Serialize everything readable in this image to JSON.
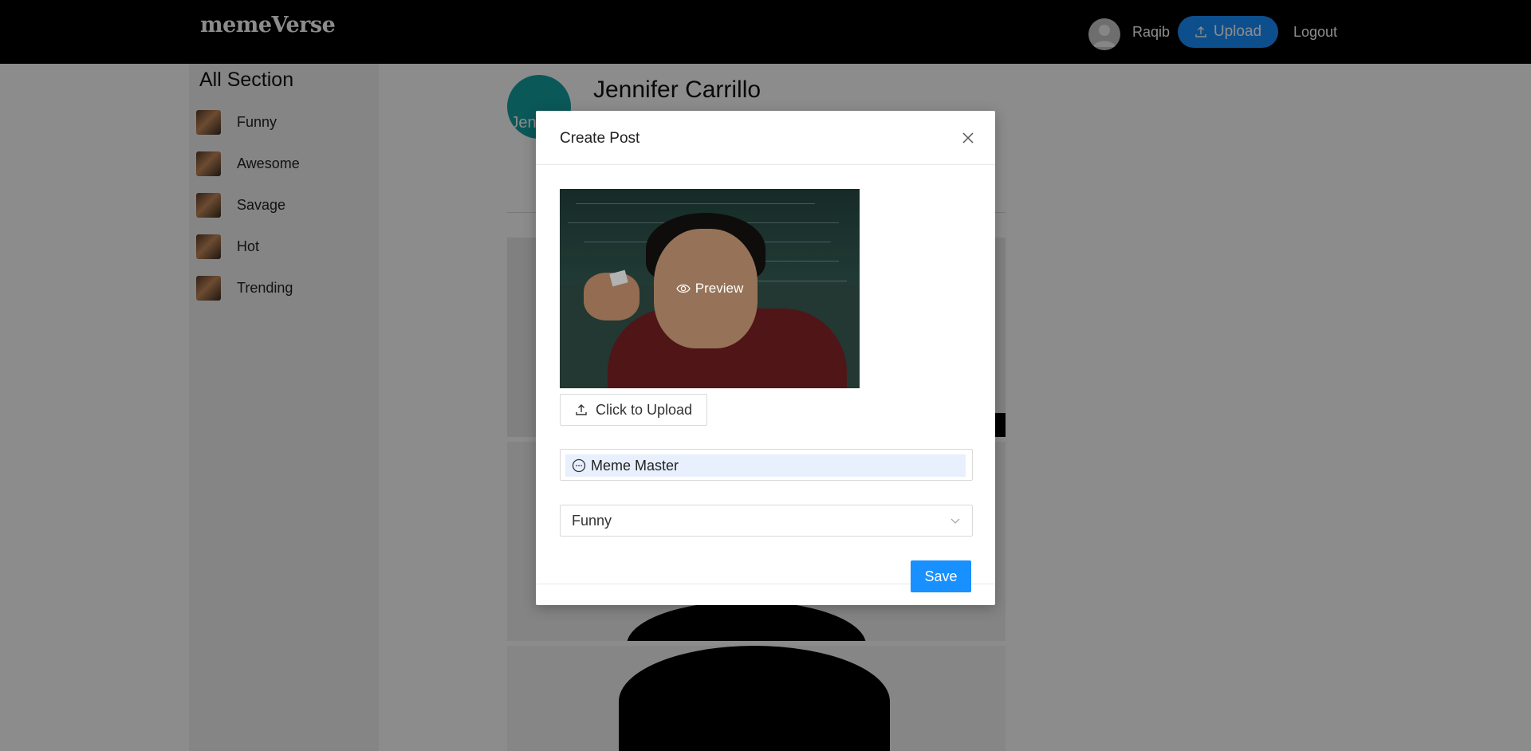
{
  "header": {
    "logo": "memeVerse",
    "username": "Raqib",
    "upload_label": "Upload",
    "logout_label": "Logout"
  },
  "sidebar": {
    "title": "All Section",
    "items": [
      {
        "label": "Funny"
      },
      {
        "label": "Awesome"
      },
      {
        "label": "Savage"
      },
      {
        "label": "Hot"
      },
      {
        "label": "Trending"
      }
    ]
  },
  "profile": {
    "avatar_text": "Jennifer",
    "name": "Jennifer Carrillo"
  },
  "modal": {
    "title": "Create Post",
    "preview_label": "Preview",
    "upload_label": "Click to Upload",
    "name_value": "Meme Master",
    "category_value": "Funny",
    "save_label": "Save"
  },
  "colors": {
    "accent": "#1890ff",
    "avatar_bg": "#15a0a3",
    "topbar": "#000000"
  }
}
